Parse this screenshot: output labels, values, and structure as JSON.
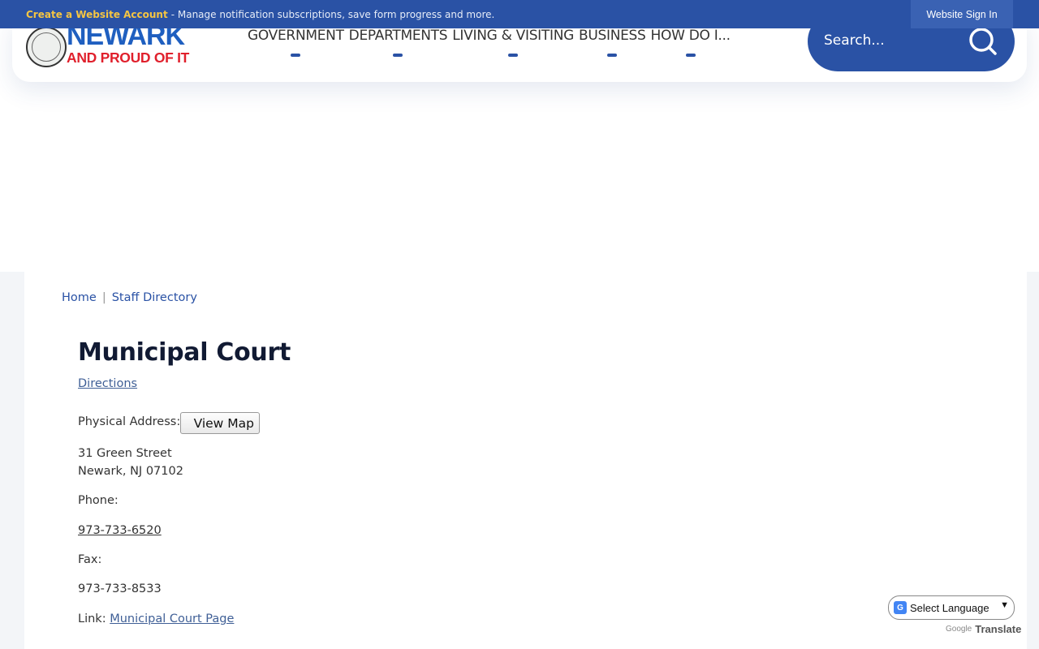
{
  "topbar": {
    "create_account": "Create a Website Account",
    "message": "- Manage notification subscriptions, save form progress and more.",
    "sign_in": "Website Sign In"
  },
  "logo": {
    "line1": "NEWARK",
    "line2": "AND PROUD OF IT"
  },
  "nav": {
    "items": [
      "GOVERNMENT",
      "DEPARTMENTS",
      "LIVING & VISITING",
      "BUSINESS",
      "HOW DO I..."
    ]
  },
  "search": {
    "placeholder": "Search...",
    "icon": "search-icon"
  },
  "breadcrumb": {
    "home": "Home",
    "separator": "|",
    "current": "Staff Directory"
  },
  "page": {
    "title": "Municipal Court",
    "directions": "Directions",
    "address_label": "Physical Address:",
    "view_map": "View Map",
    "address_line1": "31 Green Street",
    "address_line2": "Newark, NJ 07102",
    "phone_label": "Phone:",
    "phone": "973-733-6520",
    "fax_label": "Fax:",
    "fax": "973-733-8533",
    "link_label": "Link:",
    "link_text": "Municipal Court Page"
  },
  "translate": {
    "select_label": "Select Language",
    "powered_by": "Google",
    "translate": "Translate"
  },
  "colors": {
    "primary": "#2a52a5",
    "accent": "#f5c542",
    "title": "#111a33",
    "link": "#3f5f96"
  }
}
